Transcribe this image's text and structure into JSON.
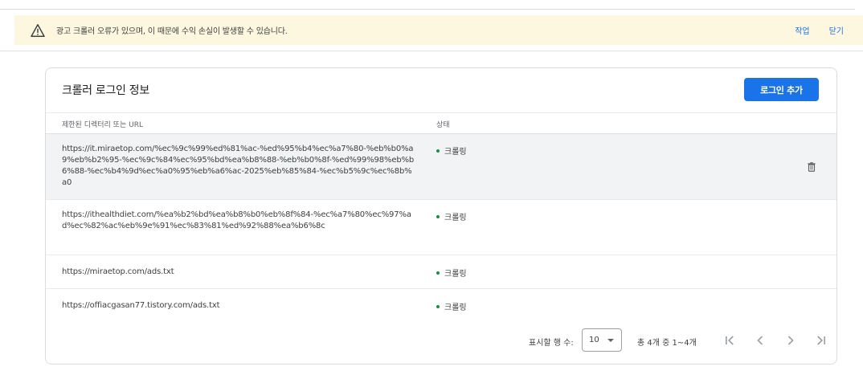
{
  "banner": {
    "message": "광고 크롤러 오류가 있으며, 이 때문에 수익 손실이 발생할 수 있습니다.",
    "action_label": "작업",
    "close_label": "닫기",
    "icon": "warning-icon"
  },
  "card": {
    "title": "크롤러 로그인 정보",
    "add_button_label": "로그인 추가",
    "accent_color": "#1a73e8"
  },
  "table": {
    "columns": [
      "제한된 디렉터리 또는 URL",
      "상태"
    ],
    "rows": [
      {
        "url": "https://it.miraetop.com/%ec%9c%99%ed%81%ac-%ed%95%b4%ec%a7%80-%eb%b0%a9%eb%b2%95-%ec%9c%84%ec%95%bd%ea%b8%88-%eb%b0%8f-%ed%99%98%eb%b6%88-%ec%b4%9d%ec%a0%95%eb%a6%ac-2025%eb%85%84-%ec%b5%9c%ec%8b%a0",
        "status": "크롤링"
      },
      {
        "url": "https://ithealthdiet.com/%ea%b2%bd%ea%b8%b0%eb%8f%84-%ec%a7%80%ec%97%ad%ec%82%ac%eb%9e%91%ec%83%81%ed%92%88%ea%b6%8c",
        "status": "크롤링"
      },
      {
        "url": "https://miraetop.com/ads.txt",
        "status": "크롤링"
      },
      {
        "url": "https://offiacgasan77.tistory.com/ads.txt",
        "status": "크롤링"
      }
    ],
    "status_color": "#1e8e3e"
  },
  "pagination": {
    "rows_label": "표시할 행 수:",
    "rows_value": "10",
    "range_text": "총 4개 중 1~4개"
  }
}
